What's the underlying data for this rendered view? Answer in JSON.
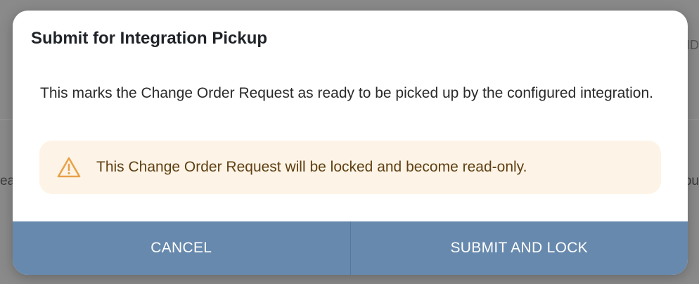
{
  "background": {
    "left_fragment": "ea",
    "right_fragment": "ou",
    "top_right_fragment": "ID"
  },
  "dialog": {
    "title": "Submit for Integration Pickup",
    "message": "This marks the Change Order Request as ready to be picked up by the configured integration.",
    "warning": {
      "icon": "warning-triangle-icon",
      "text": "This Change Order Request will be locked and become read-only."
    },
    "buttons": {
      "cancel": "CANCEL",
      "submit": "SUBMIT AND LOCK"
    }
  },
  "colors": {
    "footer": "#6789ad",
    "warning_bg": "#fdf4e7",
    "warning_icon": "#e9a24a",
    "warning_text": "#5f3f12"
  }
}
